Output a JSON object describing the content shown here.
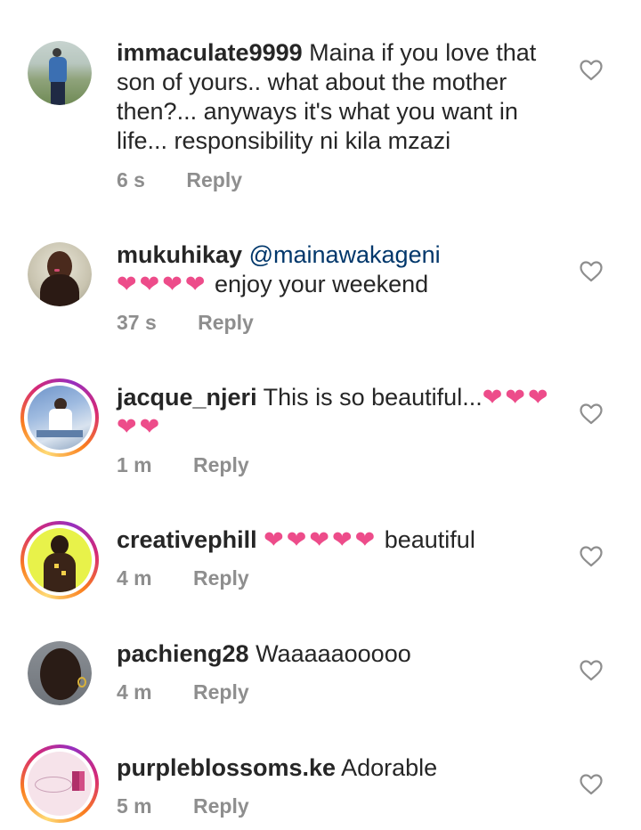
{
  "colors": {
    "username": "#262626",
    "text": "#262626",
    "meta": "#8e8e8e",
    "mention": "#00376b",
    "heart": "#ed4c8a"
  },
  "comments": [
    {
      "username": "immaculate9999",
      "text": "Maina if you love that son of yours.. what about the mother then?... anyways it's what you want in life... responsibility ni kila mzazi",
      "time": "6 s",
      "reply_label": "Reply",
      "story_ring": false
    },
    {
      "username": "mukuhikay",
      "mention": "@mainawakageni",
      "hearts": "❤❤❤❤",
      "text": "enjoy your weekend",
      "time": "37 s",
      "reply_label": "Reply",
      "story_ring": false
    },
    {
      "username": "jacque_njeri",
      "text": "This is so beautiful...",
      "hearts": "❤❤❤❤❤",
      "time": "1 m",
      "reply_label": "Reply",
      "story_ring": true
    },
    {
      "username": "creativephill",
      "hearts": "❤❤❤❤❤",
      "text": "beautiful",
      "time": "4 m",
      "reply_label": "Reply",
      "story_ring": true
    },
    {
      "username": "pachieng28",
      "text": "Waaaaaooooo",
      "time": "4 m",
      "reply_label": "Reply",
      "story_ring": false
    },
    {
      "username": "purpleblossoms.ke",
      "text": "Adorable",
      "time": "5 m",
      "reply_label": "Reply",
      "story_ring": true
    }
  ]
}
